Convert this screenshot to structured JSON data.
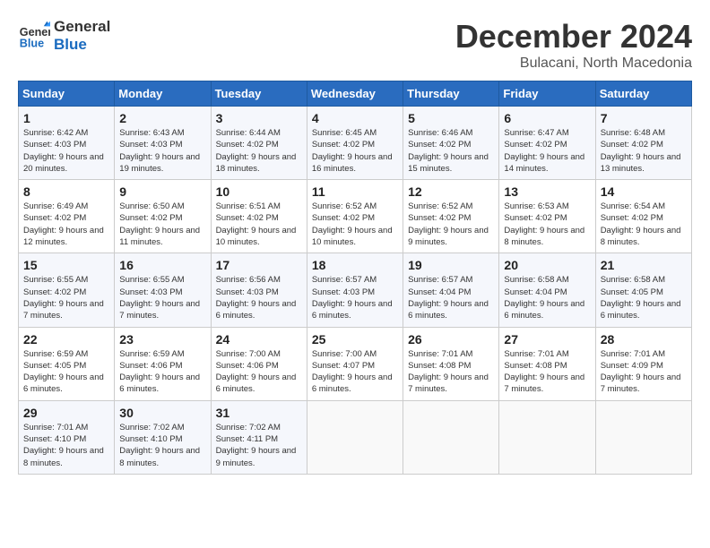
{
  "header": {
    "logo_line1": "General",
    "logo_line2": "Blue",
    "month_title": "December 2024",
    "subtitle": "Bulacani, North Macedonia"
  },
  "days_of_week": [
    "Sunday",
    "Monday",
    "Tuesday",
    "Wednesday",
    "Thursday",
    "Friday",
    "Saturday"
  ],
  "weeks": [
    [
      {
        "day": "1",
        "sunrise": "Sunrise: 6:42 AM",
        "sunset": "Sunset: 4:03 PM",
        "daylight": "Daylight: 9 hours and 20 minutes."
      },
      {
        "day": "2",
        "sunrise": "Sunrise: 6:43 AM",
        "sunset": "Sunset: 4:03 PM",
        "daylight": "Daylight: 9 hours and 19 minutes."
      },
      {
        "day": "3",
        "sunrise": "Sunrise: 6:44 AM",
        "sunset": "Sunset: 4:02 PM",
        "daylight": "Daylight: 9 hours and 18 minutes."
      },
      {
        "day": "4",
        "sunrise": "Sunrise: 6:45 AM",
        "sunset": "Sunset: 4:02 PM",
        "daylight": "Daylight: 9 hours and 16 minutes."
      },
      {
        "day": "5",
        "sunrise": "Sunrise: 6:46 AM",
        "sunset": "Sunset: 4:02 PM",
        "daylight": "Daylight: 9 hours and 15 minutes."
      },
      {
        "day": "6",
        "sunrise": "Sunrise: 6:47 AM",
        "sunset": "Sunset: 4:02 PM",
        "daylight": "Daylight: 9 hours and 14 minutes."
      },
      {
        "day": "7",
        "sunrise": "Sunrise: 6:48 AM",
        "sunset": "Sunset: 4:02 PM",
        "daylight": "Daylight: 9 hours and 13 minutes."
      }
    ],
    [
      {
        "day": "8",
        "sunrise": "Sunrise: 6:49 AM",
        "sunset": "Sunset: 4:02 PM",
        "daylight": "Daylight: 9 hours and 12 minutes."
      },
      {
        "day": "9",
        "sunrise": "Sunrise: 6:50 AM",
        "sunset": "Sunset: 4:02 PM",
        "daylight": "Daylight: 9 hours and 11 minutes."
      },
      {
        "day": "10",
        "sunrise": "Sunrise: 6:51 AM",
        "sunset": "Sunset: 4:02 PM",
        "daylight": "Daylight: 9 hours and 10 minutes."
      },
      {
        "day": "11",
        "sunrise": "Sunrise: 6:52 AM",
        "sunset": "Sunset: 4:02 PM",
        "daylight": "Daylight: 9 hours and 10 minutes."
      },
      {
        "day": "12",
        "sunrise": "Sunrise: 6:52 AM",
        "sunset": "Sunset: 4:02 PM",
        "daylight": "Daylight: 9 hours and 9 minutes."
      },
      {
        "day": "13",
        "sunrise": "Sunrise: 6:53 AM",
        "sunset": "Sunset: 4:02 PM",
        "daylight": "Daylight: 9 hours and 8 minutes."
      },
      {
        "day": "14",
        "sunrise": "Sunrise: 6:54 AM",
        "sunset": "Sunset: 4:02 PM",
        "daylight": "Daylight: 9 hours and 8 minutes."
      }
    ],
    [
      {
        "day": "15",
        "sunrise": "Sunrise: 6:55 AM",
        "sunset": "Sunset: 4:02 PM",
        "daylight": "Daylight: 9 hours and 7 minutes."
      },
      {
        "day": "16",
        "sunrise": "Sunrise: 6:55 AM",
        "sunset": "Sunset: 4:03 PM",
        "daylight": "Daylight: 9 hours and 7 minutes."
      },
      {
        "day": "17",
        "sunrise": "Sunrise: 6:56 AM",
        "sunset": "Sunset: 4:03 PM",
        "daylight": "Daylight: 9 hours and 6 minutes."
      },
      {
        "day": "18",
        "sunrise": "Sunrise: 6:57 AM",
        "sunset": "Sunset: 4:03 PM",
        "daylight": "Daylight: 9 hours and 6 minutes."
      },
      {
        "day": "19",
        "sunrise": "Sunrise: 6:57 AM",
        "sunset": "Sunset: 4:04 PM",
        "daylight": "Daylight: 9 hours and 6 minutes."
      },
      {
        "day": "20",
        "sunrise": "Sunrise: 6:58 AM",
        "sunset": "Sunset: 4:04 PM",
        "daylight": "Daylight: 9 hours and 6 minutes."
      },
      {
        "day": "21",
        "sunrise": "Sunrise: 6:58 AM",
        "sunset": "Sunset: 4:05 PM",
        "daylight": "Daylight: 9 hours and 6 minutes."
      }
    ],
    [
      {
        "day": "22",
        "sunrise": "Sunrise: 6:59 AM",
        "sunset": "Sunset: 4:05 PM",
        "daylight": "Daylight: 9 hours and 6 minutes."
      },
      {
        "day": "23",
        "sunrise": "Sunrise: 6:59 AM",
        "sunset": "Sunset: 4:06 PM",
        "daylight": "Daylight: 9 hours and 6 minutes."
      },
      {
        "day": "24",
        "sunrise": "Sunrise: 7:00 AM",
        "sunset": "Sunset: 4:06 PM",
        "daylight": "Daylight: 9 hours and 6 minutes."
      },
      {
        "day": "25",
        "sunrise": "Sunrise: 7:00 AM",
        "sunset": "Sunset: 4:07 PM",
        "daylight": "Daylight: 9 hours and 6 minutes."
      },
      {
        "day": "26",
        "sunrise": "Sunrise: 7:01 AM",
        "sunset": "Sunset: 4:08 PM",
        "daylight": "Daylight: 9 hours and 7 minutes."
      },
      {
        "day": "27",
        "sunrise": "Sunrise: 7:01 AM",
        "sunset": "Sunset: 4:08 PM",
        "daylight": "Daylight: 9 hours and 7 minutes."
      },
      {
        "day": "28",
        "sunrise": "Sunrise: 7:01 AM",
        "sunset": "Sunset: 4:09 PM",
        "daylight": "Daylight: 9 hours and 7 minutes."
      }
    ],
    [
      {
        "day": "29",
        "sunrise": "Sunrise: 7:01 AM",
        "sunset": "Sunset: 4:10 PM",
        "daylight": "Daylight: 9 hours and 8 minutes."
      },
      {
        "day": "30",
        "sunrise": "Sunrise: 7:02 AM",
        "sunset": "Sunset: 4:10 PM",
        "daylight": "Daylight: 9 hours and 8 minutes."
      },
      {
        "day": "31",
        "sunrise": "Sunrise: 7:02 AM",
        "sunset": "Sunset: 4:11 PM",
        "daylight": "Daylight: 9 hours and 9 minutes."
      },
      null,
      null,
      null,
      null
    ]
  ]
}
